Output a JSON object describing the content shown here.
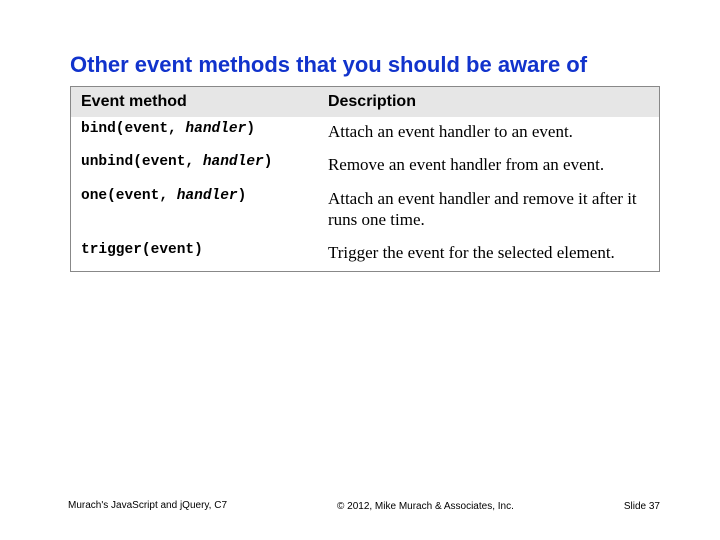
{
  "title": "Other event methods that you should be aware of",
  "table": {
    "headers": [
      "Event method",
      "Description"
    ],
    "rows": [
      {
        "method_prefix": "bind(event, ",
        "method_param": "handler",
        "method_suffix": ")",
        "desc": "Attach an event handler to an event."
      },
      {
        "method_prefix": "unbind(event, ",
        "method_param": "handler",
        "method_suffix": ")",
        "desc": "Remove an event handler from an event."
      },
      {
        "method_prefix": "one(event, ",
        "method_param": "handler",
        "method_suffix": ")",
        "desc": "Attach an event handler and remove it after it runs one time."
      },
      {
        "method_prefix": "trigger(event)",
        "method_param": "",
        "method_suffix": "",
        "desc": "Trigger the event for the selected element."
      }
    ]
  },
  "footer": {
    "left": "Murach's JavaScript and jQuery, C7",
    "center": "© 2012, Mike Murach & Associates, Inc.",
    "right": "Slide 37"
  },
  "chart_data": {
    "type": "table",
    "title": "Other event methods that you should be aware of",
    "columns": [
      "Event method",
      "Description"
    ],
    "rows": [
      [
        "bind(event, handler)",
        "Attach an event handler to an event."
      ],
      [
        "unbind(event, handler)",
        "Remove an event handler from an event."
      ],
      [
        "one(event, handler)",
        "Attach an event handler and remove it after it runs one time."
      ],
      [
        "trigger(event)",
        "Trigger the event for the selected element."
      ]
    ]
  }
}
